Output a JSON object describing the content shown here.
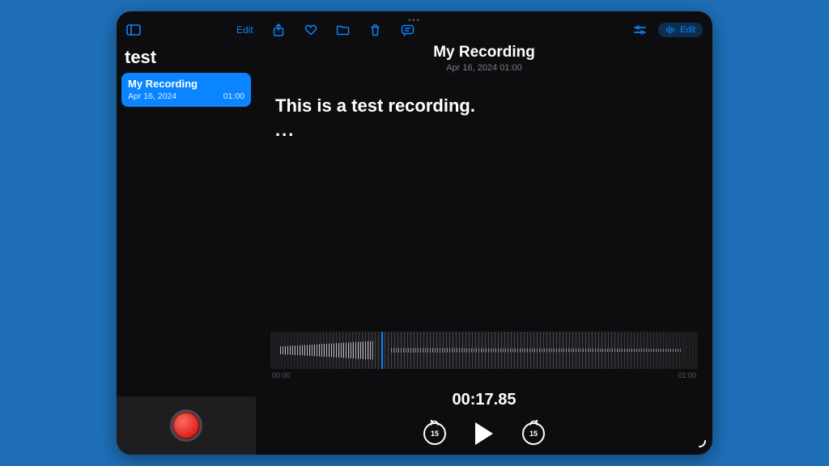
{
  "toolbar": {
    "edit_left_label": "Edit",
    "edit_right_label": "Edit",
    "skip_seconds": "15"
  },
  "sidebar": {
    "title": "test",
    "items": [
      {
        "title": "My Recording",
        "date": "Apr 16, 2024",
        "duration": "01:00"
      }
    ]
  },
  "main": {
    "title": "My Recording",
    "subtitle": "Apr 16, 2024   01:00",
    "transcript_line1": "This is a test recording.",
    "transcript_line2": "...",
    "time_start": "00:00",
    "time_end": "01:00",
    "current_time": "00:17.85"
  }
}
